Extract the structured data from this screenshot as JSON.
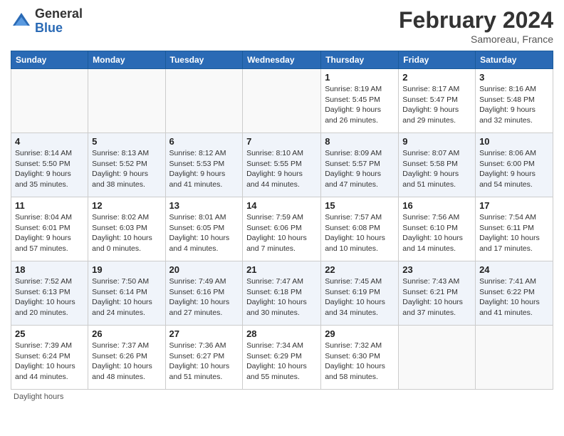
{
  "header": {
    "logo_general": "General",
    "logo_blue": "Blue",
    "month_year": "February 2024",
    "location": "Samoreau, France"
  },
  "days_of_week": [
    "Sunday",
    "Monday",
    "Tuesday",
    "Wednesday",
    "Thursday",
    "Friday",
    "Saturday"
  ],
  "weeks": [
    [
      {
        "day": "",
        "sunrise": "",
        "sunset": "",
        "daylight": ""
      },
      {
        "day": "",
        "sunrise": "",
        "sunset": "",
        "daylight": ""
      },
      {
        "day": "",
        "sunrise": "",
        "sunset": "",
        "daylight": ""
      },
      {
        "day": "",
        "sunrise": "",
        "sunset": "",
        "daylight": ""
      },
      {
        "day": "1",
        "sunrise": "Sunrise: 8:19 AM",
        "sunset": "Sunset: 5:45 PM",
        "daylight": "Daylight: 9 hours and 26 minutes."
      },
      {
        "day": "2",
        "sunrise": "Sunrise: 8:17 AM",
        "sunset": "Sunset: 5:47 PM",
        "daylight": "Daylight: 9 hours and 29 minutes."
      },
      {
        "day": "3",
        "sunrise": "Sunrise: 8:16 AM",
        "sunset": "Sunset: 5:48 PM",
        "daylight": "Daylight: 9 hours and 32 minutes."
      }
    ],
    [
      {
        "day": "4",
        "sunrise": "Sunrise: 8:14 AM",
        "sunset": "Sunset: 5:50 PM",
        "daylight": "Daylight: 9 hours and 35 minutes."
      },
      {
        "day": "5",
        "sunrise": "Sunrise: 8:13 AM",
        "sunset": "Sunset: 5:52 PM",
        "daylight": "Daylight: 9 hours and 38 minutes."
      },
      {
        "day": "6",
        "sunrise": "Sunrise: 8:12 AM",
        "sunset": "Sunset: 5:53 PM",
        "daylight": "Daylight: 9 hours and 41 minutes."
      },
      {
        "day": "7",
        "sunrise": "Sunrise: 8:10 AM",
        "sunset": "Sunset: 5:55 PM",
        "daylight": "Daylight: 9 hours and 44 minutes."
      },
      {
        "day": "8",
        "sunrise": "Sunrise: 8:09 AM",
        "sunset": "Sunset: 5:57 PM",
        "daylight": "Daylight: 9 hours and 47 minutes."
      },
      {
        "day": "9",
        "sunrise": "Sunrise: 8:07 AM",
        "sunset": "Sunset: 5:58 PM",
        "daylight": "Daylight: 9 hours and 51 minutes."
      },
      {
        "day": "10",
        "sunrise": "Sunrise: 8:06 AM",
        "sunset": "Sunset: 6:00 PM",
        "daylight": "Daylight: 9 hours and 54 minutes."
      }
    ],
    [
      {
        "day": "11",
        "sunrise": "Sunrise: 8:04 AM",
        "sunset": "Sunset: 6:01 PM",
        "daylight": "Daylight: 9 hours and 57 minutes."
      },
      {
        "day": "12",
        "sunrise": "Sunrise: 8:02 AM",
        "sunset": "Sunset: 6:03 PM",
        "daylight": "Daylight: 10 hours and 0 minutes."
      },
      {
        "day": "13",
        "sunrise": "Sunrise: 8:01 AM",
        "sunset": "Sunset: 6:05 PM",
        "daylight": "Daylight: 10 hours and 4 minutes."
      },
      {
        "day": "14",
        "sunrise": "Sunrise: 7:59 AM",
        "sunset": "Sunset: 6:06 PM",
        "daylight": "Daylight: 10 hours and 7 minutes."
      },
      {
        "day": "15",
        "sunrise": "Sunrise: 7:57 AM",
        "sunset": "Sunset: 6:08 PM",
        "daylight": "Daylight: 10 hours and 10 minutes."
      },
      {
        "day": "16",
        "sunrise": "Sunrise: 7:56 AM",
        "sunset": "Sunset: 6:10 PM",
        "daylight": "Daylight: 10 hours and 14 minutes."
      },
      {
        "day": "17",
        "sunrise": "Sunrise: 7:54 AM",
        "sunset": "Sunset: 6:11 PM",
        "daylight": "Daylight: 10 hours and 17 minutes."
      }
    ],
    [
      {
        "day": "18",
        "sunrise": "Sunrise: 7:52 AM",
        "sunset": "Sunset: 6:13 PM",
        "daylight": "Daylight: 10 hours and 20 minutes."
      },
      {
        "day": "19",
        "sunrise": "Sunrise: 7:50 AM",
        "sunset": "Sunset: 6:14 PM",
        "daylight": "Daylight: 10 hours and 24 minutes."
      },
      {
        "day": "20",
        "sunrise": "Sunrise: 7:49 AM",
        "sunset": "Sunset: 6:16 PM",
        "daylight": "Daylight: 10 hours and 27 minutes."
      },
      {
        "day": "21",
        "sunrise": "Sunrise: 7:47 AM",
        "sunset": "Sunset: 6:18 PM",
        "daylight": "Daylight: 10 hours and 30 minutes."
      },
      {
        "day": "22",
        "sunrise": "Sunrise: 7:45 AM",
        "sunset": "Sunset: 6:19 PM",
        "daylight": "Daylight: 10 hours and 34 minutes."
      },
      {
        "day": "23",
        "sunrise": "Sunrise: 7:43 AM",
        "sunset": "Sunset: 6:21 PM",
        "daylight": "Daylight: 10 hours and 37 minutes."
      },
      {
        "day": "24",
        "sunrise": "Sunrise: 7:41 AM",
        "sunset": "Sunset: 6:22 PM",
        "daylight": "Daylight: 10 hours and 41 minutes."
      }
    ],
    [
      {
        "day": "25",
        "sunrise": "Sunrise: 7:39 AM",
        "sunset": "Sunset: 6:24 PM",
        "daylight": "Daylight: 10 hours and 44 minutes."
      },
      {
        "day": "26",
        "sunrise": "Sunrise: 7:37 AM",
        "sunset": "Sunset: 6:26 PM",
        "daylight": "Daylight: 10 hours and 48 minutes."
      },
      {
        "day": "27",
        "sunrise": "Sunrise: 7:36 AM",
        "sunset": "Sunset: 6:27 PM",
        "daylight": "Daylight: 10 hours and 51 minutes."
      },
      {
        "day": "28",
        "sunrise": "Sunrise: 7:34 AM",
        "sunset": "Sunset: 6:29 PM",
        "daylight": "Daylight: 10 hours and 55 minutes."
      },
      {
        "day": "29",
        "sunrise": "Sunrise: 7:32 AM",
        "sunset": "Sunset: 6:30 PM",
        "daylight": "Daylight: 10 hours and 58 minutes."
      },
      {
        "day": "",
        "sunrise": "",
        "sunset": "",
        "daylight": ""
      },
      {
        "day": "",
        "sunrise": "",
        "sunset": "",
        "daylight": ""
      }
    ]
  ],
  "footer": {
    "note": "Daylight hours"
  }
}
